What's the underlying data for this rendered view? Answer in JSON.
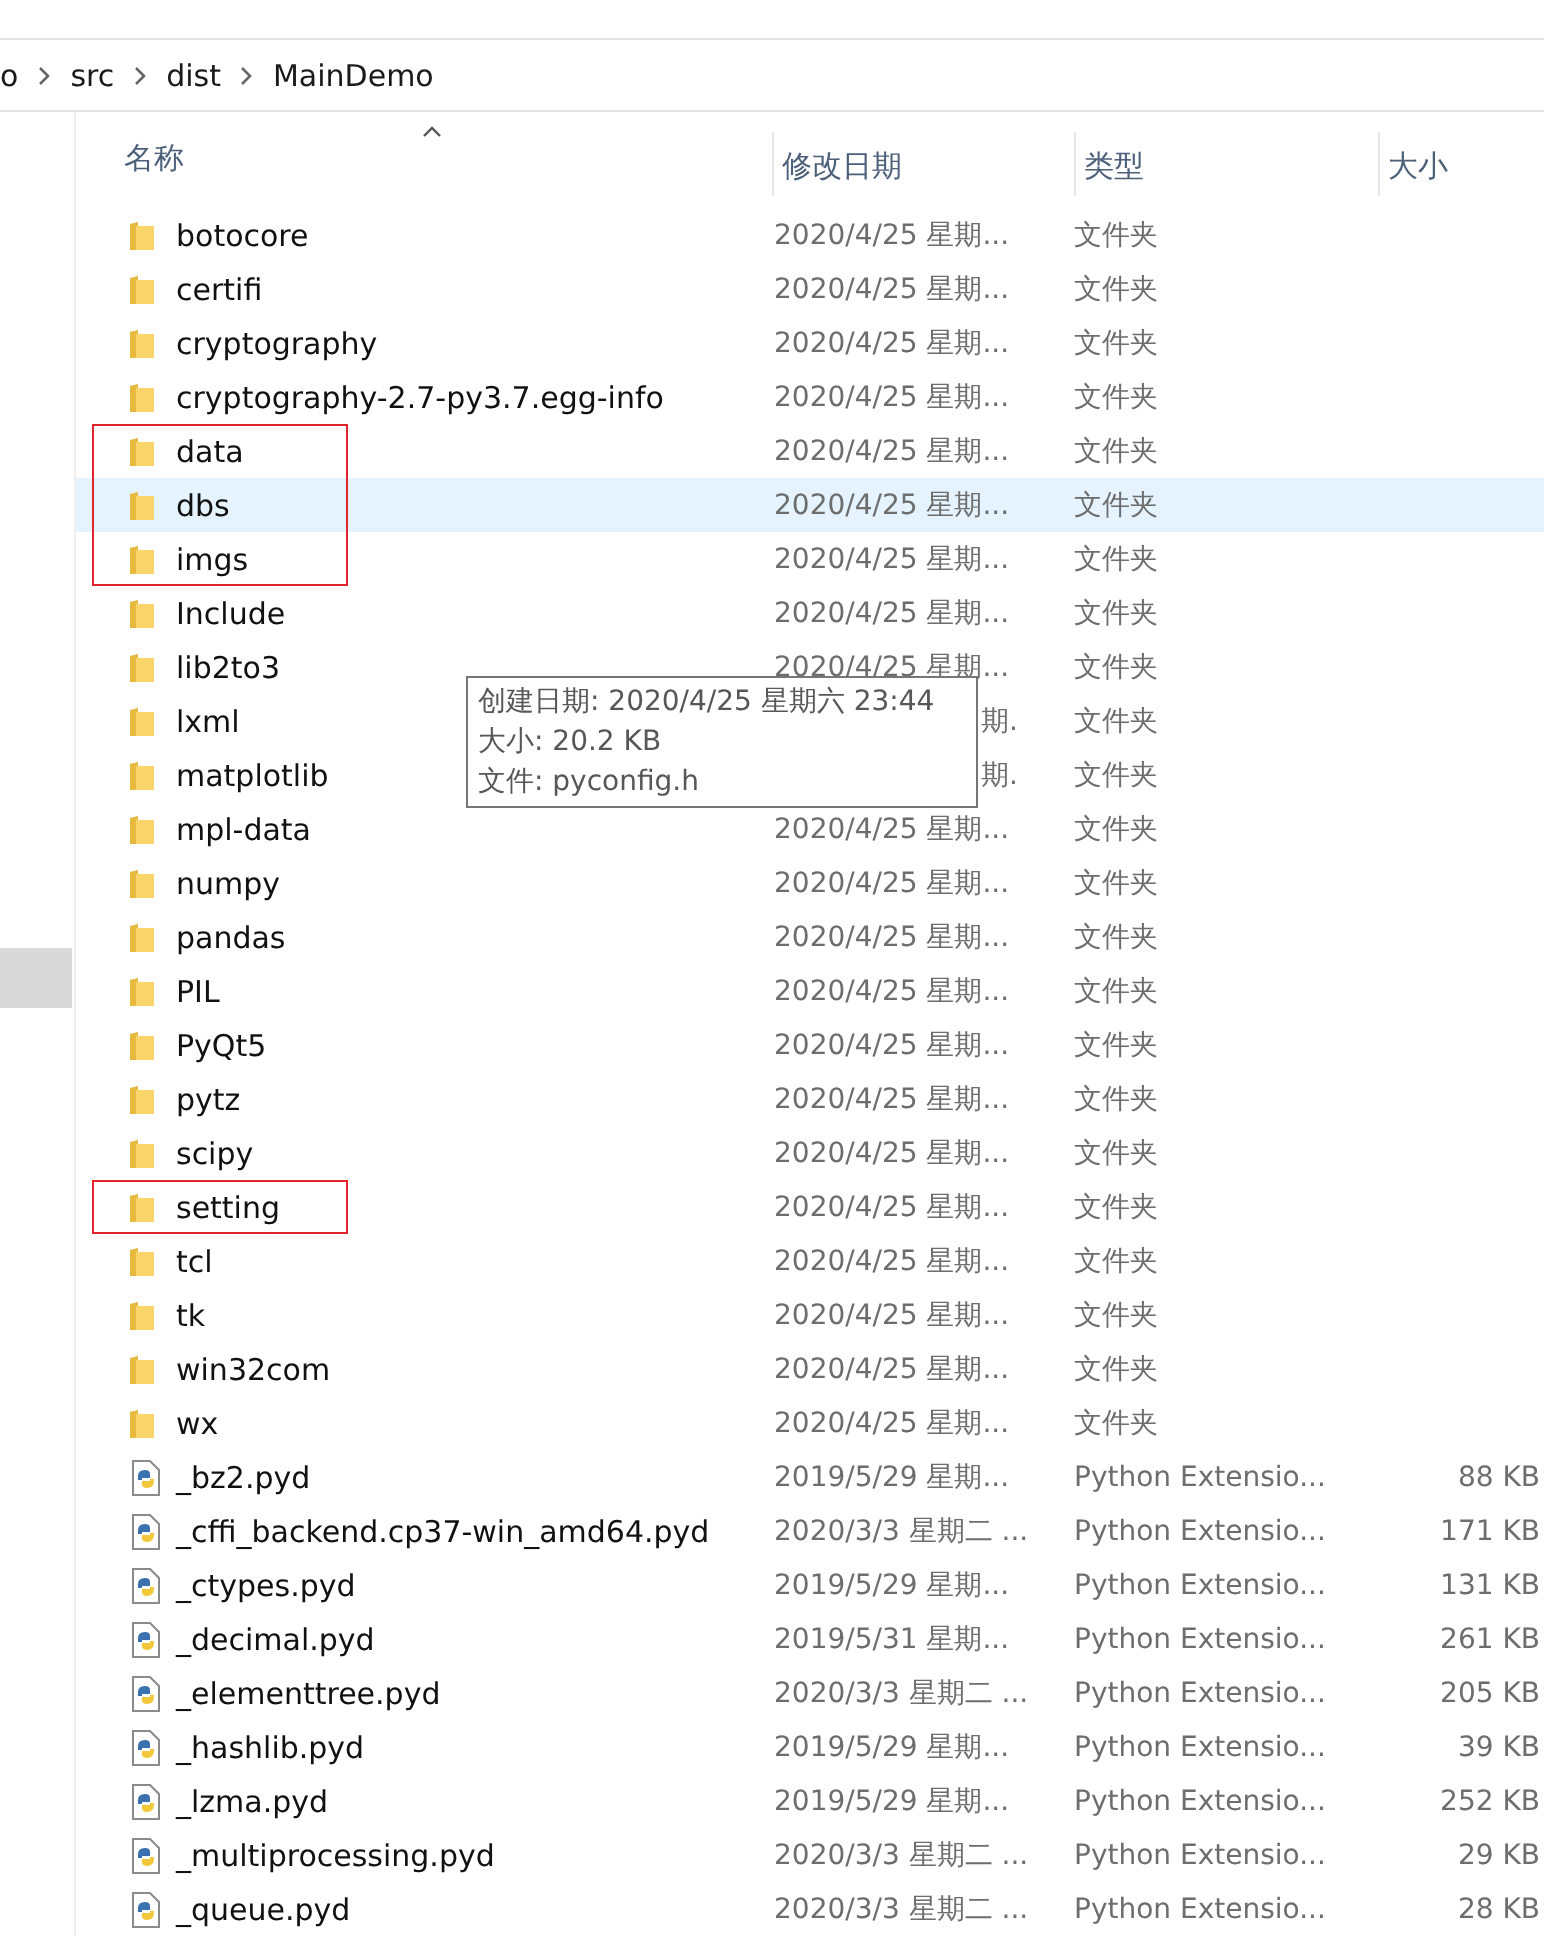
{
  "breadcrumb": [
    "o",
    "src",
    "dist",
    "MainDemo"
  ],
  "columns": [
    {
      "label": "名称",
      "sorted": true
    },
    {
      "label": "修改日期",
      "sorted": false
    },
    {
      "label": "类型",
      "sorted": false
    },
    {
      "label": "大小",
      "sorted": false
    }
  ],
  "rows": [
    {
      "kind": "folder",
      "name": "botocore",
      "date": "2020/4/25 星期...",
      "type": "文件夹",
      "selected": false,
      "red_box": false
    },
    {
      "kind": "folder",
      "name": "certifi",
      "date": "2020/4/25 星期...",
      "type": "文件夹",
      "selected": false,
      "red_box": false
    },
    {
      "kind": "folder",
      "name": "cryptography",
      "date": "2020/4/25 星期...",
      "type": "文件夹",
      "selected": false,
      "red_box": false
    },
    {
      "kind": "folder",
      "name": "cryptography-2.7-py3.7.egg-info",
      "date": "2020/4/25 星期...",
      "type": "文件夹",
      "selected": false,
      "red_box": false
    },
    {
      "kind": "folder",
      "name": "data",
      "date": "2020/4/25 星期...",
      "type": "文件夹",
      "selected": false,
      "red_box": true
    },
    {
      "kind": "folder",
      "name": "dbs",
      "date": "2020/4/25 星期...",
      "type": "文件夹",
      "selected": true,
      "red_box": true
    },
    {
      "kind": "folder",
      "name": "imgs",
      "date": "2020/4/25 星期...",
      "type": "文件夹",
      "selected": false,
      "red_box": true
    },
    {
      "kind": "folder",
      "name": "Include",
      "date": "2020/4/25 星期...",
      "type": "文件夹",
      "selected": false,
      "red_box": false
    },
    {
      "kind": "folder",
      "name": "lib2to3",
      "date": "2020/4/25 星期...",
      "type": "文件夹",
      "selected": false,
      "red_box": false
    },
    {
      "kind": "folder",
      "name": "lxml",
      "date": "期.",
      "date_covered": true,
      "type": "文件夹",
      "selected": false,
      "red_box": false
    },
    {
      "kind": "folder",
      "name": "matplotlib",
      "date": "期.",
      "date_covered": true,
      "type": "文件夹",
      "selected": false,
      "red_box": false
    },
    {
      "kind": "folder",
      "name": "mpl-data",
      "date": "2020/4/25 星期...",
      "type": "文件夹",
      "selected": false,
      "red_box": false
    },
    {
      "kind": "folder",
      "name": "numpy",
      "date": "2020/4/25 星期...",
      "type": "文件夹",
      "selected": false,
      "red_box": false
    },
    {
      "kind": "folder",
      "name": "pandas",
      "date": "2020/4/25 星期...",
      "type": "文件夹",
      "selected": false,
      "red_box": false
    },
    {
      "kind": "folder",
      "name": "PIL",
      "date": "2020/4/25 星期...",
      "type": "文件夹",
      "selected": false,
      "red_box": false
    },
    {
      "kind": "folder",
      "name": "PyQt5",
      "date": "2020/4/25 星期...",
      "type": "文件夹",
      "selected": false,
      "red_box": false
    },
    {
      "kind": "folder",
      "name": "pytz",
      "date": "2020/4/25 星期...",
      "type": "文件夹",
      "selected": false,
      "red_box": false
    },
    {
      "kind": "folder",
      "name": "scipy",
      "date": "2020/4/25 星期...",
      "type": "文件夹",
      "selected": false,
      "red_box": false
    },
    {
      "kind": "folder",
      "name": "setting",
      "date": "2020/4/25 星期...",
      "type": "文件夹",
      "selected": false,
      "red_box": true
    },
    {
      "kind": "folder",
      "name": "tcl",
      "date": "2020/4/25 星期...",
      "type": "文件夹",
      "selected": false,
      "red_box": false
    },
    {
      "kind": "folder",
      "name": "tk",
      "date": "2020/4/25 星期...",
      "type": "文件夹",
      "selected": false,
      "red_box": false
    },
    {
      "kind": "folder",
      "name": "win32com",
      "date": "2020/4/25 星期...",
      "type": "文件夹",
      "selected": false,
      "red_box": false
    },
    {
      "kind": "folder",
      "name": "wx",
      "date": "2020/4/25 星期...",
      "type": "文件夹",
      "selected": false,
      "red_box": false
    },
    {
      "kind": "pyd",
      "name": "_bz2.pyd",
      "date": "2019/5/29 星期...",
      "type": "Python Extensio...",
      "size": "88 KB",
      "selected": false,
      "red_box": false
    },
    {
      "kind": "pyd",
      "name": "_cffi_backend.cp37-win_amd64.pyd",
      "date": "2020/3/3 星期二 ...",
      "type": "Python Extensio...",
      "size": "171 KB",
      "selected": false,
      "red_box": false
    },
    {
      "kind": "pyd",
      "name": "_ctypes.pyd",
      "date": "2019/5/29 星期...",
      "type": "Python Extensio...",
      "size": "131 KB",
      "selected": false,
      "red_box": false
    },
    {
      "kind": "pyd",
      "name": "_decimal.pyd",
      "date": "2019/5/31 星期...",
      "type": "Python Extensio...",
      "size": "261 KB",
      "selected": false,
      "red_box": false
    },
    {
      "kind": "pyd",
      "name": "_elementtree.pyd",
      "date": "2020/3/3 星期二 ...",
      "type": "Python Extensio...",
      "size": "205 KB",
      "selected": false,
      "red_box": false
    },
    {
      "kind": "pyd",
      "name": "_hashlib.pyd",
      "date": "2019/5/29 星期...",
      "type": "Python Extensio...",
      "size": "39 KB",
      "selected": false,
      "red_box": false
    },
    {
      "kind": "pyd",
      "name": "_lzma.pyd",
      "date": "2019/5/29 星期...",
      "type": "Python Extensio...",
      "size": "252 KB",
      "selected": false,
      "red_box": false
    },
    {
      "kind": "pyd",
      "name": "_multiprocessing.pyd",
      "date": "2020/3/3 星期二 ...",
      "type": "Python Extensio...",
      "size": "29 KB",
      "selected": false,
      "red_box": false
    },
    {
      "kind": "pyd",
      "name": "_queue.pyd",
      "date": "2020/3/3 星期二 ...",
      "type": "Python Extensio...",
      "size": "28 KB",
      "selected": false,
      "red_box": false
    }
  ],
  "tooltip": {
    "lines": [
      "创建日期: 2020/4/25 星期六 23:44",
      "大小: 20.2 KB",
      "文件: pyconfig.h"
    ]
  }
}
